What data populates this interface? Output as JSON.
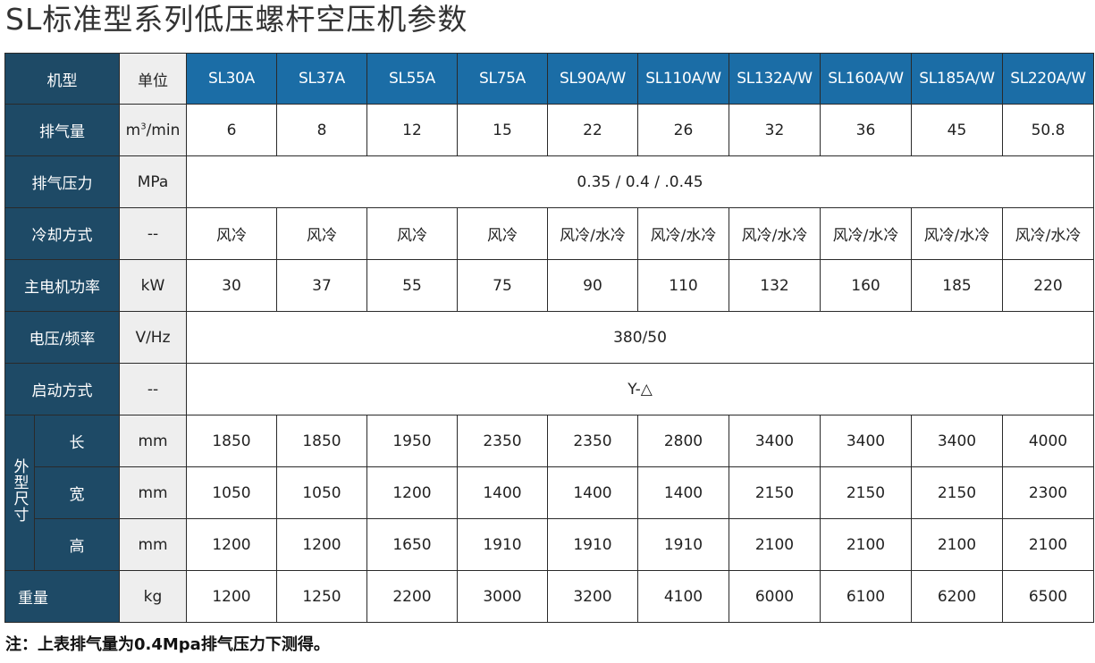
{
  "title": "SL标准型系列低压螺杆空压机参数",
  "table": {
    "header": {
      "label": "机型",
      "unit": "单位",
      "models": [
        "SL30A",
        "SL37A",
        "SL55A",
        "SL75A",
        "SL90A/W",
        "SL110A/W",
        "SL132A/W",
        "SL160A/W",
        "SL185A/W",
        "SL220A/W"
      ]
    },
    "displacement": {
      "label": "排气量",
      "unit_base": "m",
      "unit_sup": "3",
      "unit_rest": "/min",
      "values": [
        "6",
        "8",
        "12",
        "15",
        "22",
        "26",
        "32",
        "36",
        "45",
        "50.8"
      ]
    },
    "pressure": {
      "label": "排气压力",
      "unit": "MPa",
      "value": "0.35 / 0.4 / .0.45"
    },
    "cooling": {
      "label": "冷却方式",
      "unit": "--",
      "values": [
        "风冷",
        "风冷",
        "风冷",
        "风冷",
        "风冷/水冷",
        "风冷/水冷",
        "风冷/水冷",
        "风冷/水冷",
        "风冷/水冷",
        "风冷/水冷"
      ]
    },
    "power": {
      "label": "主电机功率",
      "unit": "kW",
      "values": [
        "30",
        "37",
        "55",
        "75",
        "90",
        "110",
        "132",
        "160",
        "185",
        "220"
      ]
    },
    "voltage": {
      "label": "电压/频率",
      "unit": "V/Hz",
      "value": "380/50"
    },
    "start": {
      "label": "启动方式",
      "unit": "--",
      "value": "Y-△"
    },
    "dimensions": {
      "label": "外型尺寸",
      "length": {
        "label": "长",
        "unit": "mm",
        "values": [
          "1850",
          "1850",
          "1950",
          "2350",
          "2350",
          "2800",
          "3400",
          "3400",
          "3400",
          "4000"
        ]
      },
      "width": {
        "label": "宽",
        "unit": "mm",
        "values": [
          "1050",
          "1050",
          "1200",
          "1400",
          "1400",
          "1400",
          "2150",
          "2150",
          "2150",
          "2300"
        ]
      },
      "height": {
        "label": "高",
        "unit": "mm",
        "values": [
          "1200",
          "1200",
          "1650",
          "1910",
          "1910",
          "1910",
          "2100",
          "2100",
          "2100",
          "2100"
        ]
      }
    },
    "weight": {
      "label": "重量",
      "unit": "kg",
      "values": [
        "1200",
        "1250",
        "2200",
        "3000",
        "3200",
        "4100",
        "6000",
        "6100",
        "6200",
        "6500"
      ]
    }
  },
  "note": "注：上表排气量为0.4Mpa排气压力下测得。",
  "colors": {
    "label_bg": "#1e4a66",
    "header_bg": "#1b6da6",
    "unit_bg": "#eeeeee"
  }
}
